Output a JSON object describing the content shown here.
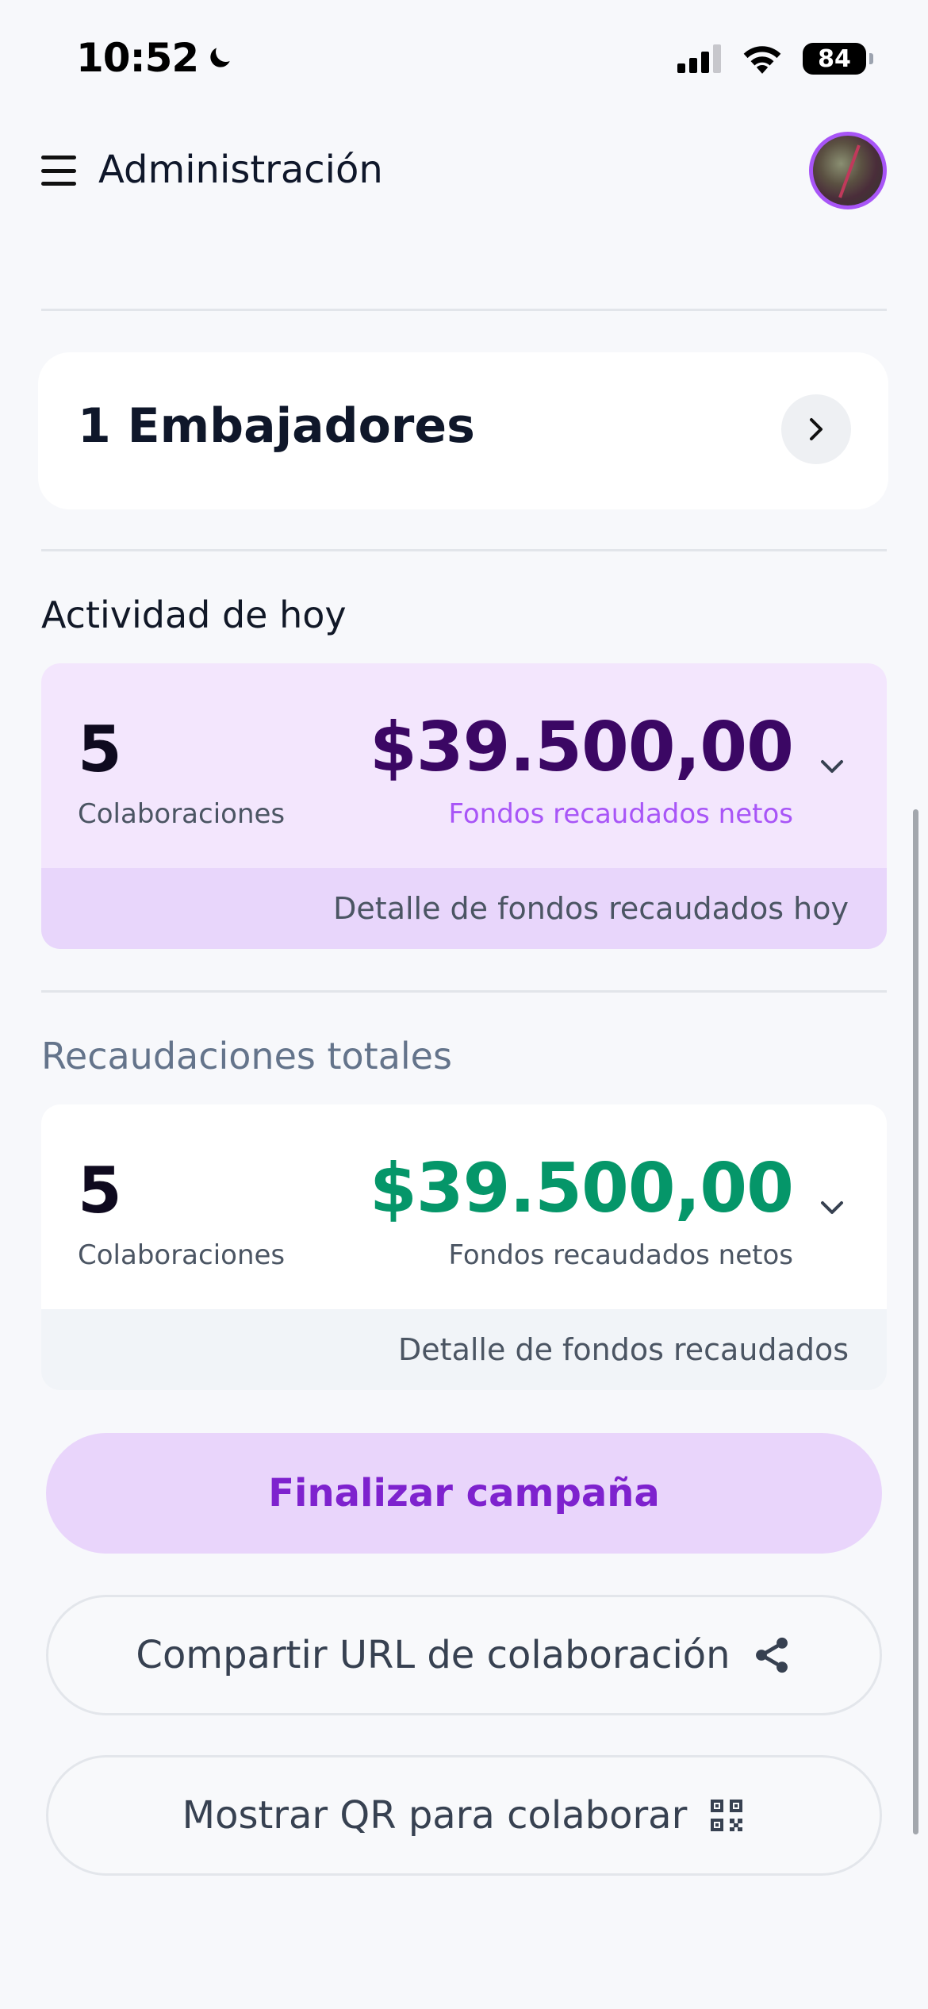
{
  "status_bar": {
    "time": "10:52",
    "battery": "84"
  },
  "header": {
    "title": "Administración"
  },
  "ambassadors": {
    "label": "1 Embajadores"
  },
  "today": {
    "section_title": "Actividad de hoy",
    "count": "5",
    "count_label": "Colaboraciones",
    "amount": "$39.500,00",
    "amount_label": "Fondos recaudados netos",
    "detail_link": "Detalle de fondos recaudados hoy"
  },
  "totals": {
    "section_title": "Recaudaciones totales",
    "count": "5",
    "count_label": "Colaboraciones",
    "amount": "$39.500,00",
    "amount_label": "Fondos recaudados netos",
    "detail_link": "Detalle de fondos recaudados"
  },
  "actions": {
    "finish_label": "Finalizar campaña",
    "share_label": "Compartir URL de colaboración",
    "qr_label": "Mostrar QR para colaborar"
  },
  "colors": {
    "accent": "#7e22ce",
    "today_bg": "#f3e6fd",
    "today_footer_bg": "#e8d6fb",
    "today_amount": "#3b0764",
    "total_amount": "#059669"
  }
}
